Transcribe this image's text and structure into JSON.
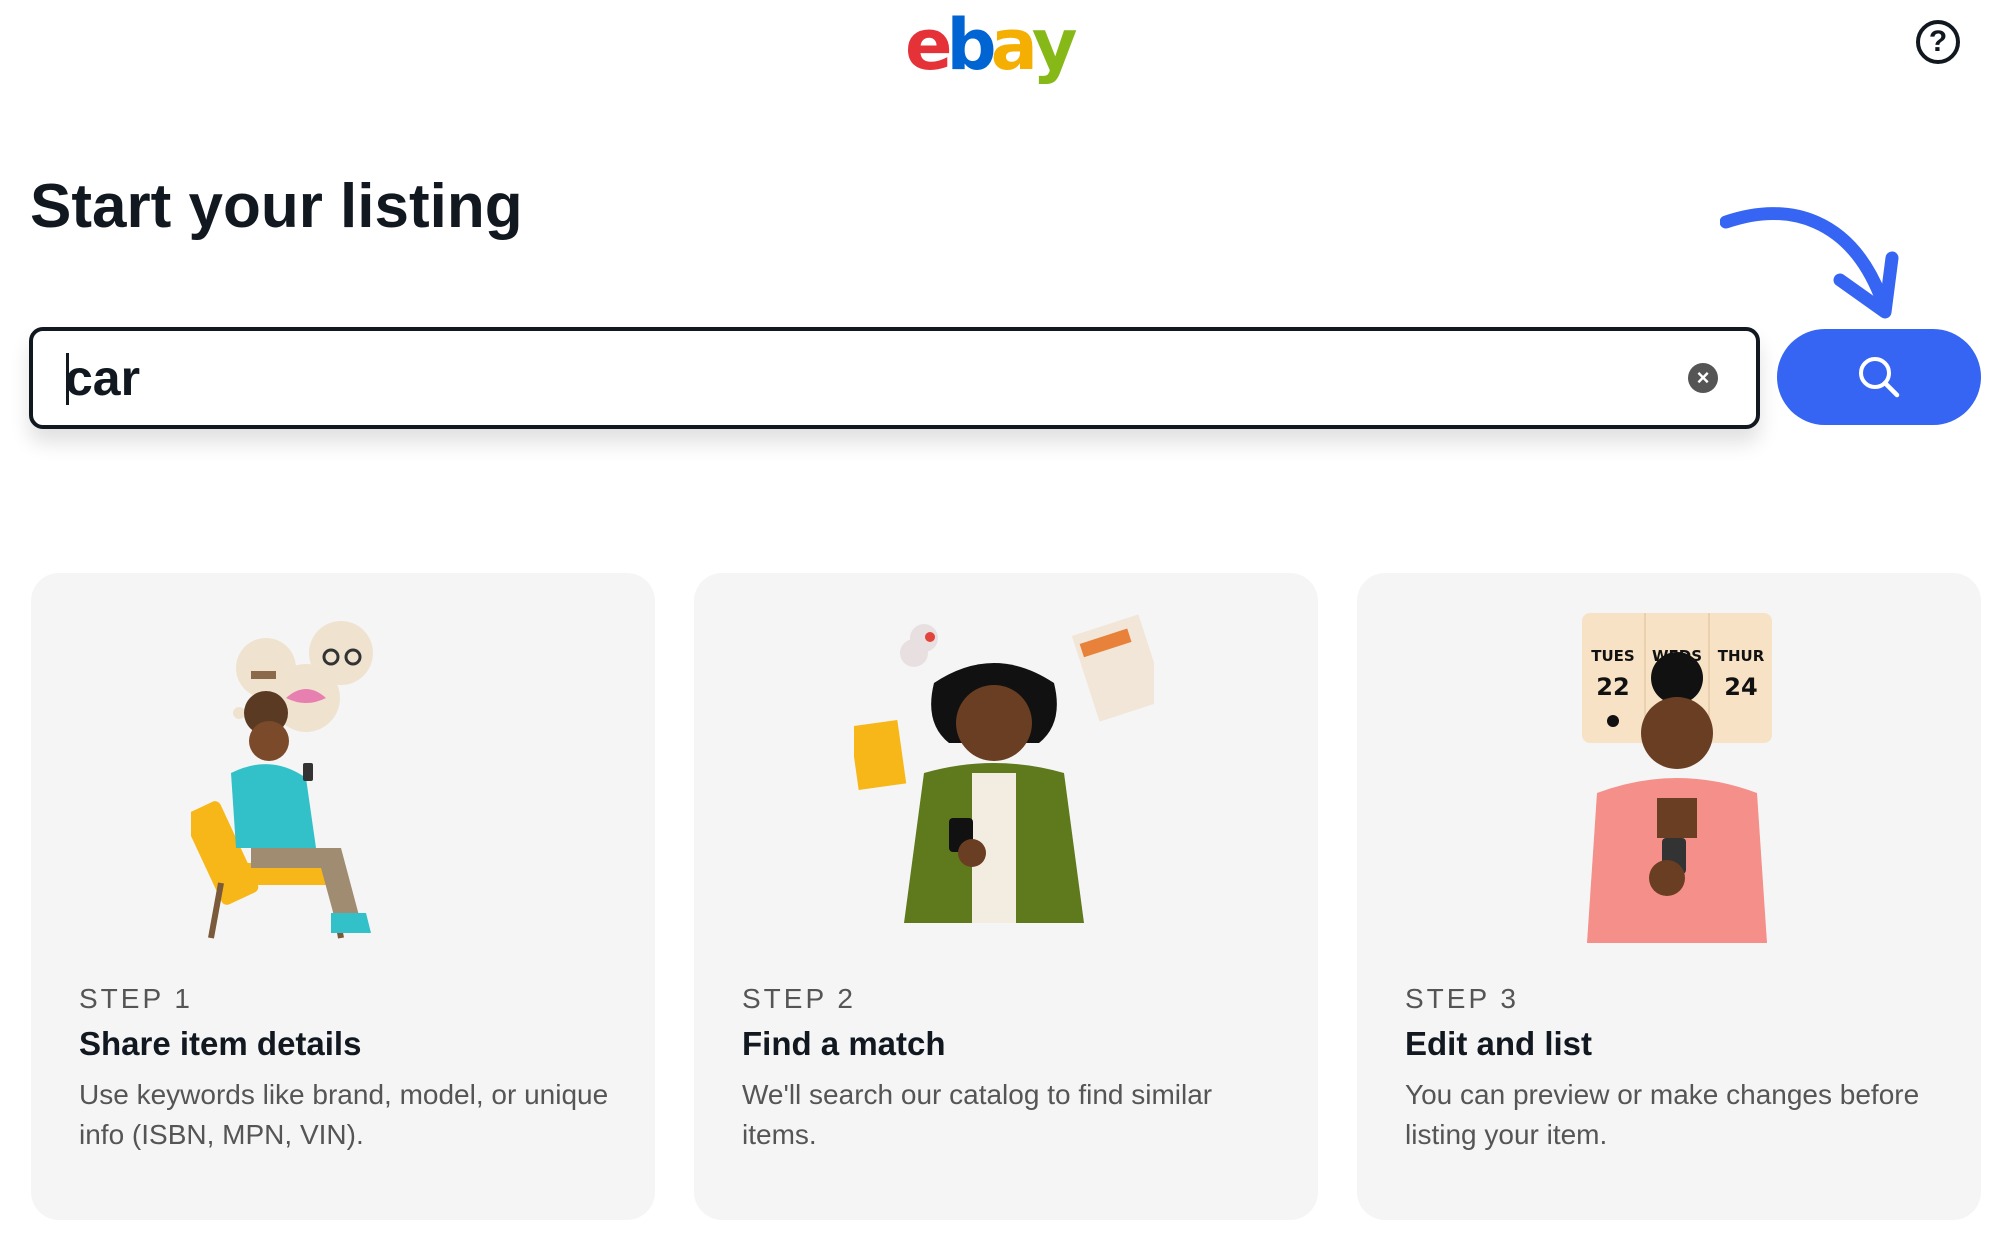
{
  "header": {
    "logo_letters": [
      "e",
      "b",
      "a",
      "y"
    ],
    "logo_colors": [
      "#e53238",
      "#0064d2",
      "#f5af02",
      "#86b817"
    ],
    "help_icon": "question-circle-icon",
    "help_label": "?"
  },
  "main": {
    "title": "Start your listing",
    "search": {
      "value": "car",
      "clear_icon": "clear-circle-icon",
      "clear_label": "×",
      "button_icon": "search-icon",
      "accent_color": "#3665f3"
    },
    "annotation_icon": "curved-arrow-icon"
  },
  "steps": [
    {
      "step": "STEP 1",
      "title": "Share item details",
      "description": "Use keywords like brand, model, or unique info (ISBN, MPN, VIN).",
      "illustration_icon": "person-in-chair-thinking-illustration"
    },
    {
      "step": "STEP 2",
      "title": "Find a match",
      "description": "We'll search our catalog to find similar items.",
      "illustration_icon": "person-with-phone-collectibles-illustration"
    },
    {
      "step": "STEP 3",
      "title": "Edit and list",
      "description": "You can preview or make changes before listing your item.",
      "illustration_icon": "person-with-calendar-illustration",
      "calendar": [
        {
          "day": "TUES",
          "date": "22"
        },
        {
          "day": "WEDS",
          "date": ""
        },
        {
          "day": "THUR",
          "date": "24"
        }
      ]
    }
  ]
}
